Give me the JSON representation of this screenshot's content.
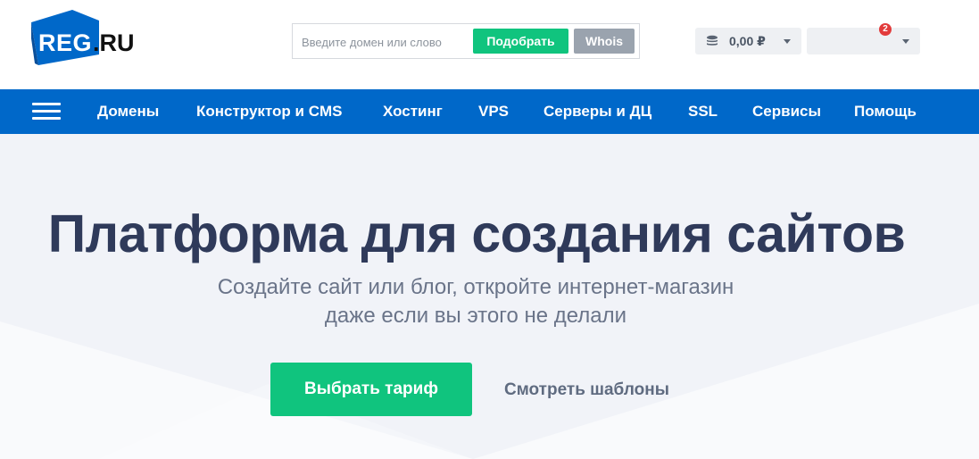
{
  "header": {
    "logo": {
      "brand": "REG",
      "suffix": ".RU"
    },
    "search": {
      "placeholder": "Введите домен или слово",
      "value": "",
      "pick_label": "Подобрать",
      "whois_label": "Whois"
    },
    "balance": {
      "value": "0,00 ₽",
      "icon": "coins-icon"
    },
    "account": {
      "notifications": "2"
    }
  },
  "nav": {
    "menu_icon": "hamburger-icon",
    "items": [
      {
        "label": "Домены"
      },
      {
        "label": "Конструктор и CMS"
      },
      {
        "label": "Хостинг"
      },
      {
        "label": "VPS"
      },
      {
        "label": "Серверы и ДЦ"
      },
      {
        "label": "SSL"
      },
      {
        "label": "Сервисы"
      },
      {
        "label": "Помощь"
      }
    ]
  },
  "hero": {
    "title": "Платформа для создания сайтов",
    "subtitle_line1": "Создайте сайт или блог, откройте интернет-магазин",
    "subtitle_line2": "даже если вы этого не делали",
    "primary_button": "Выбрать тариф",
    "secondary_link": "Смотреть шаблоны"
  },
  "colors": {
    "brand_blue": "#0068c9",
    "accent_green": "#10c47e",
    "hero_bg": "#f1f3f8",
    "title_text": "#2f3a5a",
    "badge_red": "#e23b3b"
  }
}
